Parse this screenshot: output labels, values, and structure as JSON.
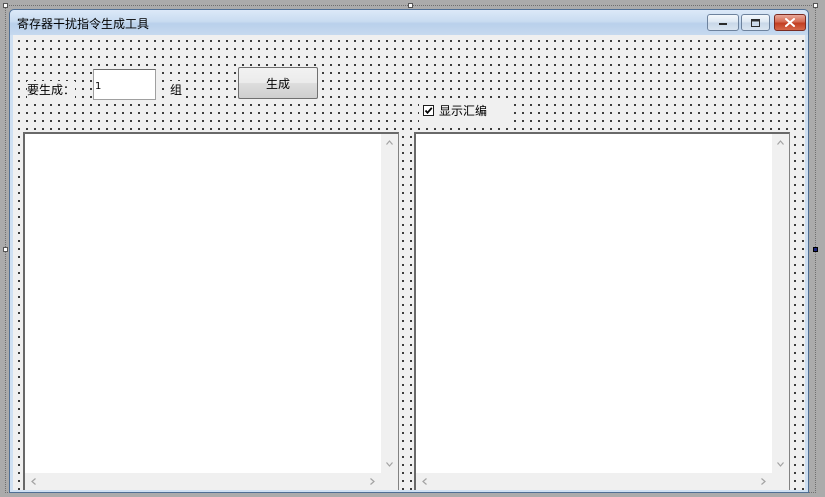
{
  "window": {
    "title": "寄存器干扰指令生成工具"
  },
  "form": {
    "generate_label": "要生成：",
    "count_value": "1",
    "group_label": "组",
    "generate_button": "生成",
    "show_assembly_label": "显示汇编",
    "show_assembly_checked": true
  },
  "left_output": {
    "value": ""
  },
  "right_output": {
    "value": ""
  },
  "icons": {
    "minimize": "minimize-icon",
    "maximize": "maximize-icon",
    "close": "close-icon",
    "checkmark": "checkmark-icon",
    "scroll_up": "chevron-up-icon",
    "scroll_down": "chevron-down-icon",
    "scroll_left": "chevron-left-icon",
    "scroll_right": "chevron-right-icon"
  },
  "colors": {
    "titlebar": "#c9dcf1",
    "close_button": "#c23e22",
    "client_background": "#f0f0f0",
    "selected_handle": "#1a237e"
  }
}
